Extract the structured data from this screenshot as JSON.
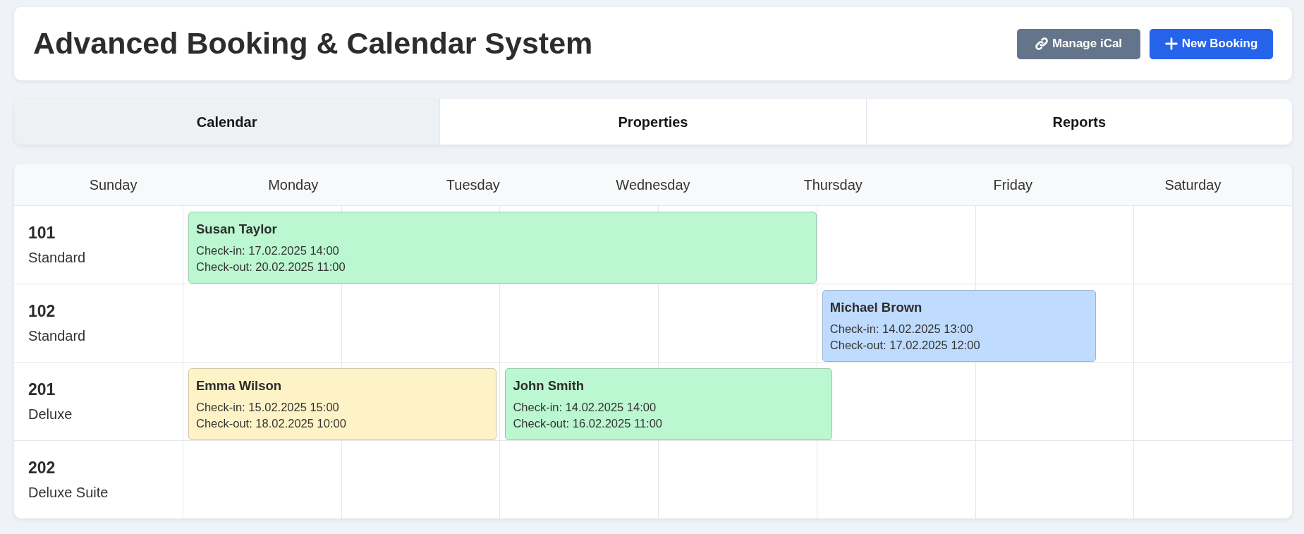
{
  "header": {
    "title": "Advanced Booking & Calendar System",
    "buttons": [
      {
        "label": "Manage iCal",
        "kind": "secondary"
      },
      {
        "label": "New Booking",
        "kind": "primary"
      }
    ]
  },
  "tabs": [
    {
      "label": "Calendar",
      "selected": true
    },
    {
      "label": "Properties",
      "selected": false
    },
    {
      "label": "Reports",
      "selected": false
    }
  ],
  "calendar": {
    "days": [
      "Sunday",
      "Monday",
      "Tuesday",
      "Wednesday",
      "Thursday",
      "Friday",
      "Saturday"
    ],
    "rooms": [
      {
        "number": "101",
        "type": "Standard",
        "bookings": [
          {
            "guest": "Susan Taylor",
            "check_in": "Check-in: 17.02.2025 14:00",
            "check_out": "Check-out: 20.02.2025 11:00",
            "color": "#bbf7d0"
          }
        ]
      },
      {
        "number": "102",
        "type": "Standard",
        "bookings": [
          {
            "guest": "Michael Brown",
            "check_in": "Check-in: 14.02.2025 13:00",
            "check_out": "Check-out: 17.02.2025 12:00",
            "color": "#bfdbfe"
          }
        ]
      },
      {
        "number": "201",
        "type": "Deluxe",
        "bookings": [
          {
            "guest": "Emma Wilson",
            "check_in": "Check-in: 15.02.2025 15:00",
            "check_out": "Check-out: 18.02.2025 10:00",
            "color": "#fef3c7"
          },
          {
            "guest": "John Smith",
            "check_in": "Check-in: 14.02.2025 14:00",
            "check_out": "Check-out: 16.02.2025 11:00",
            "color": "#bbf7d0"
          }
        ]
      },
      {
        "number": "202",
        "type": "Deluxe Suite"
      }
    ]
  }
}
